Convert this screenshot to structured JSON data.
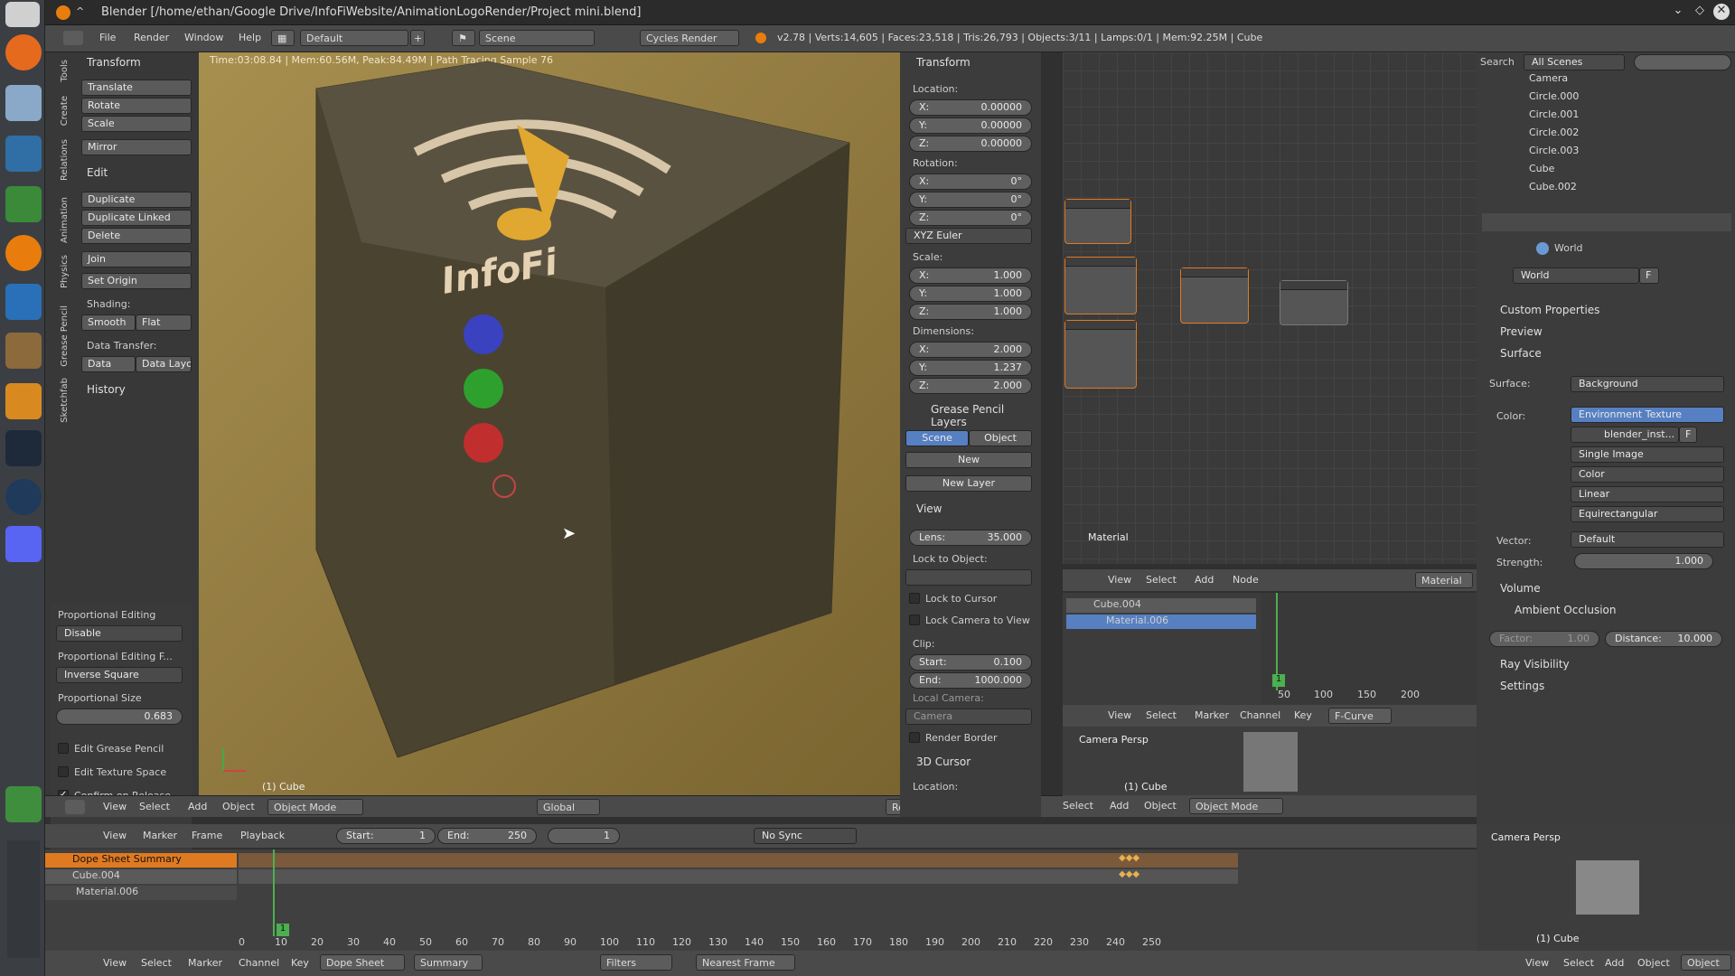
{
  "window": {
    "title": "Blender [/home/ethan/Google Drive/InfoFiWebsite/AnimationLogoRender/Project mini.blend]"
  },
  "info_header": {
    "menus": [
      "File",
      "Render",
      "Window",
      "Help"
    ],
    "layout": "Default",
    "scene": "Scene",
    "engine": "Cycles Render",
    "stats": "v2.78 | Verts:14,605 | Faces:23,518 | Tris:26,793 | Objects:3/11 | Lamps:0/1 | Mem:92.25M | Cube"
  },
  "tool_shelf": {
    "tabs": [
      "Tools",
      "Create",
      "Relations",
      "Animation",
      "Physics",
      "Grease Pencil",
      "Sketchfab"
    ],
    "transform": {
      "title": "Transform",
      "buttons": [
        "Translate",
        "Rotate",
        "Scale",
        "Mirror"
      ]
    },
    "edit": {
      "title": "Edit",
      "buttons": [
        "Duplicate",
        "Duplicate Linked",
        "Delete",
        "Join"
      ],
      "set_origin": "Set Origin",
      "shading_label": "Shading:",
      "smooth": "Smooth",
      "flat": "Flat",
      "data_transfer_label": "Data Transfer:",
      "data": "Data",
      "data_layo": "Data Layo"
    },
    "history": {
      "title": "History"
    }
  },
  "operator_panel": {
    "prop_edit_label": "Proportional Editing",
    "prop_edit_value": "Disable",
    "prop_falloff_label": "Proportional Editing F...",
    "prop_falloff_value": "Inverse Square",
    "prop_size_label": "Proportional Size",
    "prop_size_value": "0.683",
    "edit_grease": "Edit Grease Pencil",
    "edit_texture": "Edit Texture Space",
    "confirm_release": "Confirm on Release",
    "confirm_checked": true
  },
  "viewport": {
    "render_info": "Time:03:08.84 | Mem:60.56M, Peak:84.49M | Path Tracing Sample 76",
    "object_label": "(1) Cube",
    "logo_text": "InfoFi",
    "header": {
      "menus": [
        "View",
        "Select",
        "Add",
        "Object"
      ],
      "mode": "Object Mode",
      "orientation": "Global",
      "layer": "RenderLayer"
    }
  },
  "properties_n": {
    "transform_title": "Transform",
    "location_label": "Location:",
    "location": [
      "X:",
      "0.00000",
      "Y:",
      "0.00000",
      "Z:",
      "0.00000"
    ],
    "rotation_label": "Rotation:",
    "rotation": [
      "X:",
      "0°",
      "Y:",
      "0°",
      "Z:",
      "0°"
    ],
    "rotation_mode": "XYZ Euler",
    "scale_label": "Scale:",
    "scale": [
      "X:",
      "1.000",
      "Y:",
      "1.000",
      "Z:",
      "1.000"
    ],
    "dimensions_label": "Dimensions:",
    "dimensions": [
      "X:",
      "2.000",
      "Y:",
      "1.237",
      "Z:",
      "2.000"
    ],
    "grease_title": "Grease Pencil Layers",
    "gp_scene": "Scene",
    "gp_object": "Object",
    "gp_new": "New",
    "gp_new_layer": "New Layer",
    "view_title": "View",
    "lens_label": "Lens:",
    "lens_value": "35.000",
    "lock_object_label": "Lock to Object:",
    "lock_cursor": "Lock to Cursor",
    "lock_camera": "Lock Camera to View",
    "clip_label": "Clip:",
    "clip_start_label": "Start:",
    "clip_start": "0.100",
    "clip_end_label": "End:",
    "clip_end": "1000.000",
    "local_camera_label": "Local Camera:",
    "local_camera": "Camera",
    "render_border": "Render Border",
    "cursor_title": "3D Cursor",
    "cursor_location": "Location:"
  },
  "node_editor": {
    "label": "Material",
    "header": {
      "menus": [
        "View",
        "Select",
        "Add",
        "Node"
      ],
      "material": "Material"
    }
  },
  "material_list": {
    "items": [
      "Cube.004",
      "Material.006"
    ]
  },
  "graph": {
    "ticks": [
      "50",
      "100",
      "150",
      "200"
    ],
    "frame": "1",
    "header": {
      "menus": [
        "View",
        "Select",
        "Marker",
        "Channel",
        "Key"
      ],
      "mode": "F-Curve"
    }
  },
  "camera_view_small": {
    "label": "Camera Persp",
    "object": "(1) Cube",
    "header": {
      "menus": [
        "Select",
        "Add",
        "Object"
      ],
      "mode": "Object Mode"
    }
  },
  "outliner": {
    "search_label": "Search",
    "scope": "All Scenes",
    "items": [
      "Camera",
      "Circle.000",
      "Circle.001",
      "Circle.002",
      "Circle.003",
      "Cube",
      "Cube.002"
    ]
  },
  "world_props": {
    "breadcrumb": "World",
    "world_name": "World",
    "world_f": "F",
    "sections": {
      "custom": "Custom Properties",
      "preview": "Preview",
      "surface": "Surface",
      "volume": "Volume",
      "ao": "Ambient Occlusion",
      "ray": "Ray Visibility",
      "settings": "Settings"
    },
    "surface_label": "Surface:",
    "surface_value": "Background",
    "color_label": "Color:",
    "color_value": "Environment Texture",
    "image_name": "blender_inst...",
    "image_f": "F",
    "single_image": "Single Image",
    "color_space": "Color",
    "interpolation": "Linear",
    "projection": "Equirectangular",
    "vector_label": "Vector:",
    "vector_value": "Default",
    "strength_label": "Strength:",
    "strength_value": "1.000",
    "factor_label": "Factor:",
    "factor_value": "1.00",
    "distance_label": "Distance:",
    "distance_value": "10.000"
  },
  "timeline_header": {
    "menus": [
      "View",
      "Marker",
      "Frame",
      "Playback"
    ],
    "start_label": "Start:",
    "start": "1",
    "end_label": "End:",
    "end": "250",
    "current": "1",
    "sync": "No Sync"
  },
  "dopesheet": {
    "channels": [
      "Dope Sheet Summary",
      "Cube.004",
      "Material.006"
    ],
    "ticks": [
      "0",
      "10",
      "20",
      "30",
      "40",
      "50",
      "60",
      "70",
      "80",
      "90",
      "100",
      "110",
      "120",
      "130",
      "140",
      "150",
      "160",
      "170",
      "180",
      "190",
      "200",
      "210",
      "220",
      "230",
      "240",
      "250"
    ],
    "current_frame": "1",
    "header": {
      "menus": [
        "View",
        "Select",
        "Marker",
        "Channel",
        "Key"
      ],
      "mode": "Dope Sheet",
      "summary": "Summary",
      "filters": "Filters",
      "snap": "Nearest Frame"
    }
  },
  "camera_view_bottom": {
    "label": "Camera Persp",
    "object": "(1) Cube",
    "header": {
      "menus": [
        "View",
        "Select",
        "Add",
        "Object"
      ],
      "mode": "Object"
    }
  },
  "colors": {
    "accent": "#e07a20",
    "selected_blue": "#5680c2",
    "bg": "#3c3c3c",
    "viewport_gold": "#a78f4f"
  }
}
